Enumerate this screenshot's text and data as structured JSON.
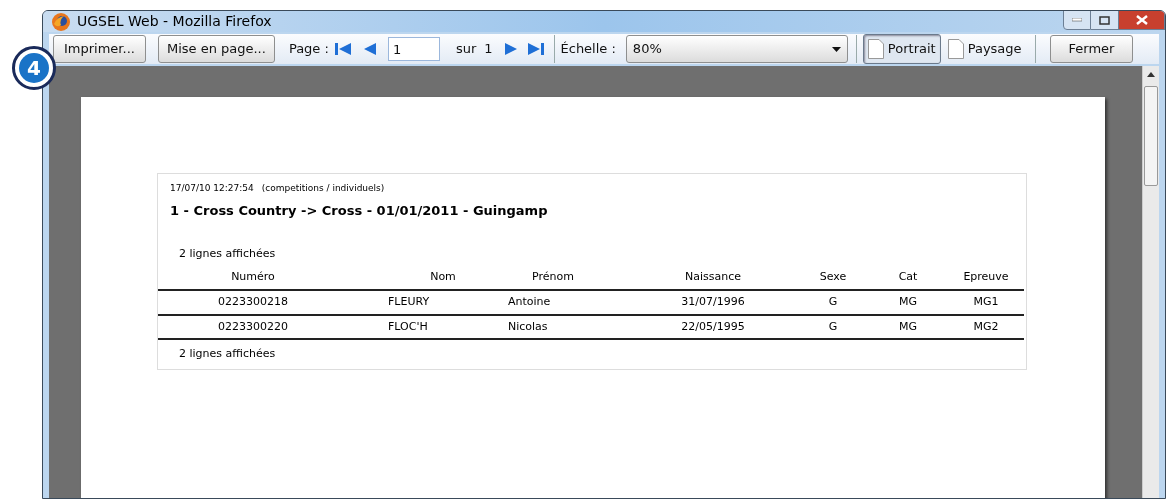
{
  "callout": {
    "label": "4"
  },
  "window": {
    "title": "UGSEL Web - Mozilla Firefox"
  },
  "toolbar": {
    "print_button": "Imprimer...",
    "page_setup_button": "Mise en page...",
    "page_label": "Page :",
    "page_value": "1",
    "of_label": "sur",
    "page_count": "1",
    "scale_label": "Échelle :",
    "scale_value": "80%",
    "orientations": [
      {
        "label": "Portrait",
        "selected": true
      },
      {
        "label": "Paysage",
        "selected": false
      }
    ],
    "close_button": "Fermer"
  },
  "report": {
    "timestamp": "17/07/10 12:27:54",
    "context": "(competitions / individuels)",
    "title": "1 - Cross Country ->  Cross - 01/01/2011 - Guingamp",
    "count_top": "2 lignes affichées",
    "columns": [
      "Numéro",
      "Nom",
      "Prénom",
      "Naissance",
      "Sexe",
      "Cat",
      "Epreuve"
    ],
    "rows": [
      [
        "0223300218",
        "FLEURY",
        "Antoine",
        "31/07/1996",
        "G",
        "MG",
        "MG1"
      ],
      [
        "0223300220",
        "FLOC'H",
        "Nicolas",
        "22/05/1995",
        "G",
        "MG",
        "MG2"
      ]
    ],
    "count_bottom": "2 lignes affichées"
  }
}
